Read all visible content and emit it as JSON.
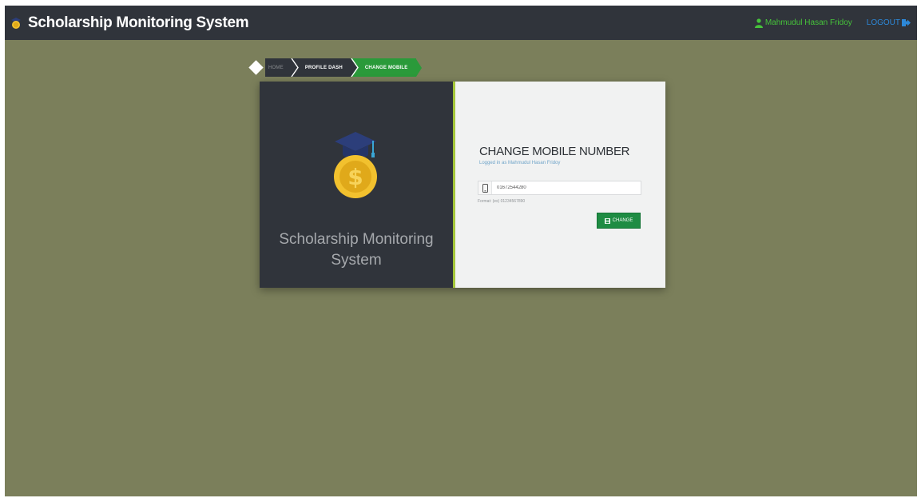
{
  "header": {
    "title": "Scholarship Monitoring System",
    "user_name": "Mahmudul Hasan Fridoy",
    "logout_label": "LOGOUT",
    "colors": {
      "bar": "#30343b",
      "user": "#46c33b",
      "logout": "#2d88d8"
    }
  },
  "breadcrumb": {
    "items": [
      {
        "label": "HOME"
      },
      {
        "label": "PROFILE DASH"
      },
      {
        "label": "CHANGE MOBILE"
      }
    ]
  },
  "card": {
    "left_title": "Scholarship Monitoring System",
    "form_title": "CHANGE MOBILE NUMBER",
    "form_subtitle": "Logged in as Mahmudul Hasan Fridoy",
    "mobile_value": "01672544280",
    "format_hint": "Format: (ex) 01234567890",
    "change_label": "CHANGE",
    "icons": [
      "graduation-cap-coin-logo",
      "phone-icon",
      "save-icon"
    ]
  }
}
